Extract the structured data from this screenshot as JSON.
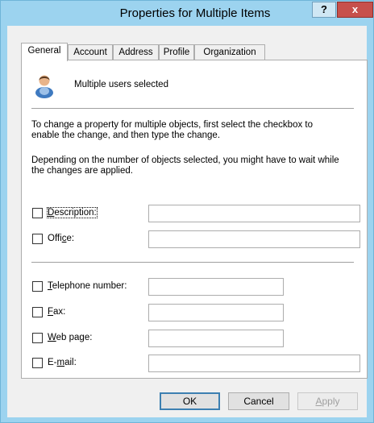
{
  "window": {
    "title": "Properties for Multiple Items",
    "help_label": "?",
    "close_label": "x"
  },
  "tabs": [
    {
      "label": "General",
      "active": true
    },
    {
      "label": "Account",
      "active": false
    },
    {
      "label": "Address",
      "active": false
    },
    {
      "label": "Profile",
      "active": false
    },
    {
      "label": "Organization",
      "active": false
    }
  ],
  "general": {
    "selected_text": "Multiple users selected",
    "instruction_1_line1": "To change a property for multiple objects, first select the checkbox to",
    "instruction_1_line2": "enable the change, and then type the change.",
    "instruction_2_line1": "Depending on the number of objects selected, you might have to wait while",
    "instruction_2_line2": "the changes are applied.",
    "fields": {
      "description": {
        "pre": "",
        "ul": "D",
        "post": "escription:",
        "checked": false,
        "value": ""
      },
      "office": {
        "pre": "Offi",
        "ul": "c",
        "post": "e:",
        "checked": false,
        "value": ""
      },
      "telephone": {
        "pre": "",
        "ul": "T",
        "post": "elephone number:",
        "checked": false,
        "value": ""
      },
      "fax": {
        "pre": "",
        "ul": "F",
        "post": "ax:",
        "checked": false,
        "value": ""
      },
      "webpage": {
        "pre": "",
        "ul": "W",
        "post": "eb page:",
        "checked": false,
        "value": ""
      },
      "email": {
        "pre": "E-",
        "ul": "m",
        "post": "ail:",
        "checked": false,
        "value": ""
      }
    }
  },
  "buttons": {
    "ok": "OK",
    "cancel": "Cancel",
    "apply_ul": "A",
    "apply_post": "pply"
  }
}
